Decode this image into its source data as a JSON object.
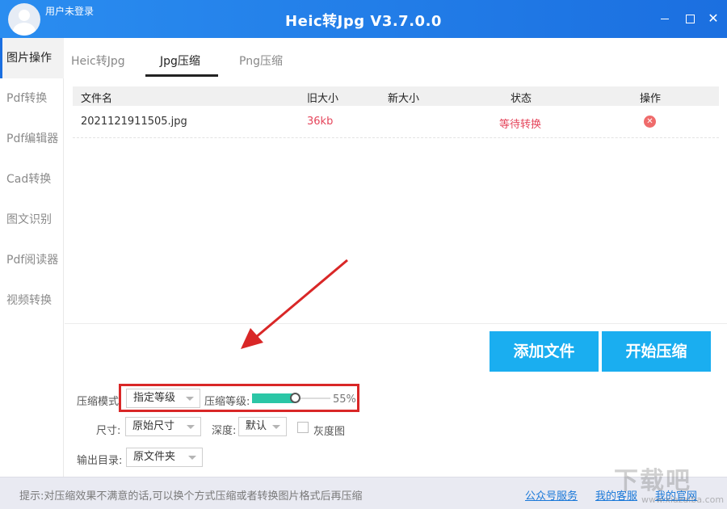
{
  "titlebar": {
    "user": "用户未登录",
    "title": "Heic转Jpg V3.7.0.0",
    "close_glyph": "✕"
  },
  "sidebar": {
    "items": [
      {
        "label": "图片操作",
        "active": true
      },
      {
        "label": "Pdf转换"
      },
      {
        "label": "Pdf编辑器"
      },
      {
        "label": "Cad转换"
      },
      {
        "label": "图文识别"
      },
      {
        "label": "Pdf阅读器"
      },
      {
        "label": "视频转换"
      }
    ]
  },
  "tabs": [
    {
      "label": "Heic转Jpg"
    },
    {
      "label": "Jpg压缩",
      "active": true
    },
    {
      "label": "Png压缩"
    }
  ],
  "table": {
    "headers": [
      "文件名",
      "旧大小",
      "新大小",
      "状态",
      "操作"
    ],
    "rows": [
      {
        "name": "2021121911505.jpg",
        "old_size": "36kb",
        "new_size": "",
        "status": "等待转换",
        "delete_glyph": "✕"
      }
    ]
  },
  "buttons": {
    "add": "添加文件",
    "start": "开始压缩"
  },
  "options": {
    "mode_label": "压缩模式",
    "mode_value": "指定等级",
    "level_label": "压缩等级:",
    "level_value": "55%",
    "level_fraction": 0.55,
    "size_label": "尺寸:",
    "size_value": "原始尺寸",
    "depth_label": "深度:",
    "depth_value": "默认",
    "gray_label": "灰度图",
    "gray_checked": false,
    "output_label": "输出目录:",
    "output_value": "原文件夹"
  },
  "footer": {
    "tip": "提示:对压缩效果不满意的话,可以换个方式压缩或者转换图片格式后再压缩",
    "links": [
      "公众号服务",
      "我的客服",
      "我的官网"
    ]
  },
  "watermark": {
    "text": "下载吧",
    "url": "www.xiazaiba.com"
  },
  "colors": {
    "titlebar": "#1b6fe0",
    "button": "#1aaef0",
    "status_red": "#e5455b",
    "slider_fill": "#2bc6a6",
    "highlight": "#d92727",
    "link": "#1a78d8"
  }
}
